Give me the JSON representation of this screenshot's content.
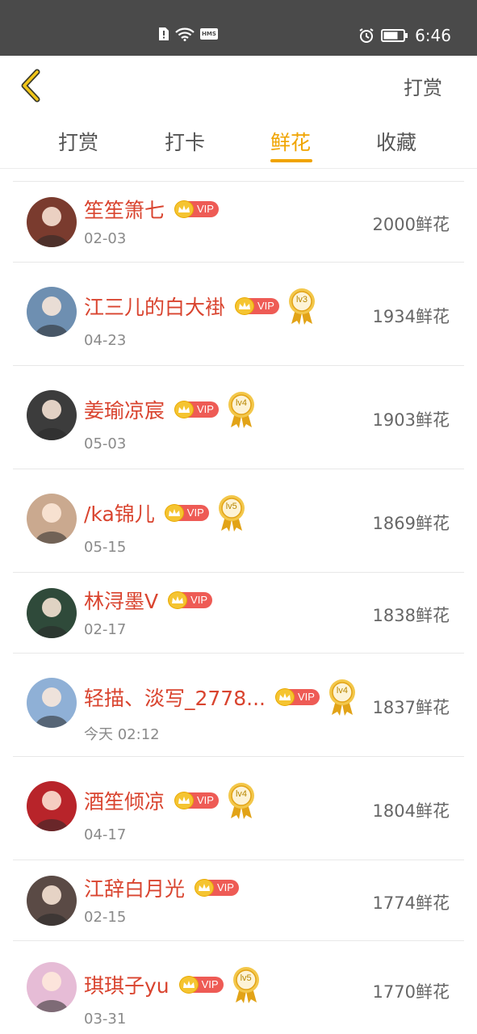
{
  "status_bar": {
    "time": "6:46"
  },
  "header": {
    "action_label": "打赏"
  },
  "tabs": [
    {
      "label": "打赏"
    },
    {
      "label": "打卡"
    },
    {
      "label": "鲜花"
    },
    {
      "label": "收藏"
    }
  ],
  "active_tab_index": 2,
  "accent_color": "#f0a400",
  "name_color": "#d9442f",
  "list": [
    {
      "name": "笙笙箫七",
      "date": "02-03",
      "flowers": "2000鲜花",
      "vip": "VIP",
      "level": "",
      "avatar_color": "#7a3b2e"
    },
    {
      "name": "江三儿的白大褂",
      "date": "04-23",
      "flowers": "1934鲜花",
      "vip": "VIP",
      "level": "lv3",
      "avatar_color": "#6e8fb1"
    },
    {
      "name": "姜瑜凉宸",
      "date": "05-03",
      "flowers": "1903鲜花",
      "vip": "VIP",
      "level": "lv4",
      "avatar_color": "#3c3c3c"
    },
    {
      "name": "/ka锦儿",
      "date": "05-15",
      "flowers": "1869鲜花",
      "vip": "VIP",
      "level": "lv5",
      "avatar_color": "#caa98f"
    },
    {
      "name": "林浔墨V",
      "date": "02-17",
      "flowers": "1838鲜花",
      "vip": "VIP",
      "level": "",
      "avatar_color": "#2f4a3a"
    },
    {
      "name": "轻描、淡写_2778...",
      "date": "今天 02:12",
      "flowers": "1837鲜花",
      "vip": "VIP",
      "level": "lv4",
      "avatar_color": "#8fb0d6"
    },
    {
      "name": "酒笙倾凉",
      "date": "04-17",
      "flowers": "1804鲜花",
      "vip": "VIP",
      "level": "lv4",
      "avatar_color": "#b8242a"
    },
    {
      "name": "江辞白月光",
      "date": "02-15",
      "flowers": "1774鲜花",
      "vip": "VIP",
      "level": "",
      "avatar_color": "#5a4a45"
    },
    {
      "name": "琪琪子yu",
      "date": "03-31",
      "flowers": "1770鲜花",
      "vip": "VIP",
      "level": "lv5",
      "avatar_color": "#e6bcd6"
    }
  ]
}
